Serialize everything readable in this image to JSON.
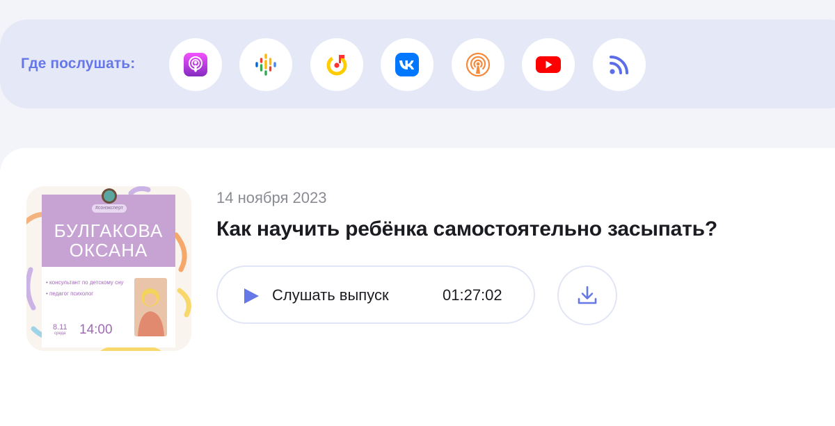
{
  "platforms": {
    "label": "Где послушать:",
    "items": [
      {
        "name": "apple-podcasts-icon",
        "color": "#b150e2"
      },
      {
        "name": "google-podcasts-icon",
        "color": "#4285f4"
      },
      {
        "name": "yandex-music-icon",
        "color": "#ffcc00"
      },
      {
        "name": "vk-icon",
        "color": "#0077ff"
      },
      {
        "name": "castbox-icon",
        "color": "#f55b23"
      },
      {
        "name": "youtube-icon",
        "color": "#ff0000"
      },
      {
        "name": "rss-icon",
        "color": "#5b6ee8"
      }
    ]
  },
  "episode": {
    "date": "14 ноября 2023",
    "title": "Как научить ребёнка самостоятельно засыпать?",
    "listen_label": "Слушать выпуск",
    "duration": "01:27:02",
    "cover": {
      "tag": "#сонэксперт",
      "name_line1": "БУЛГАКОВА",
      "name_line2": "ОКСАНА",
      "bullet1": "• консультант по детскому сну",
      "bullet2": "• педагог психолог",
      "date": "8.11",
      "day": "среда",
      "time": "14:00"
    }
  },
  "colors": {
    "accent": "#6677e8",
    "bar_bg": "#e5e9f7",
    "page_bg": "#f3f4f9",
    "button_border": "#e1e5f5",
    "cover_purple": "#c6a3d3"
  }
}
